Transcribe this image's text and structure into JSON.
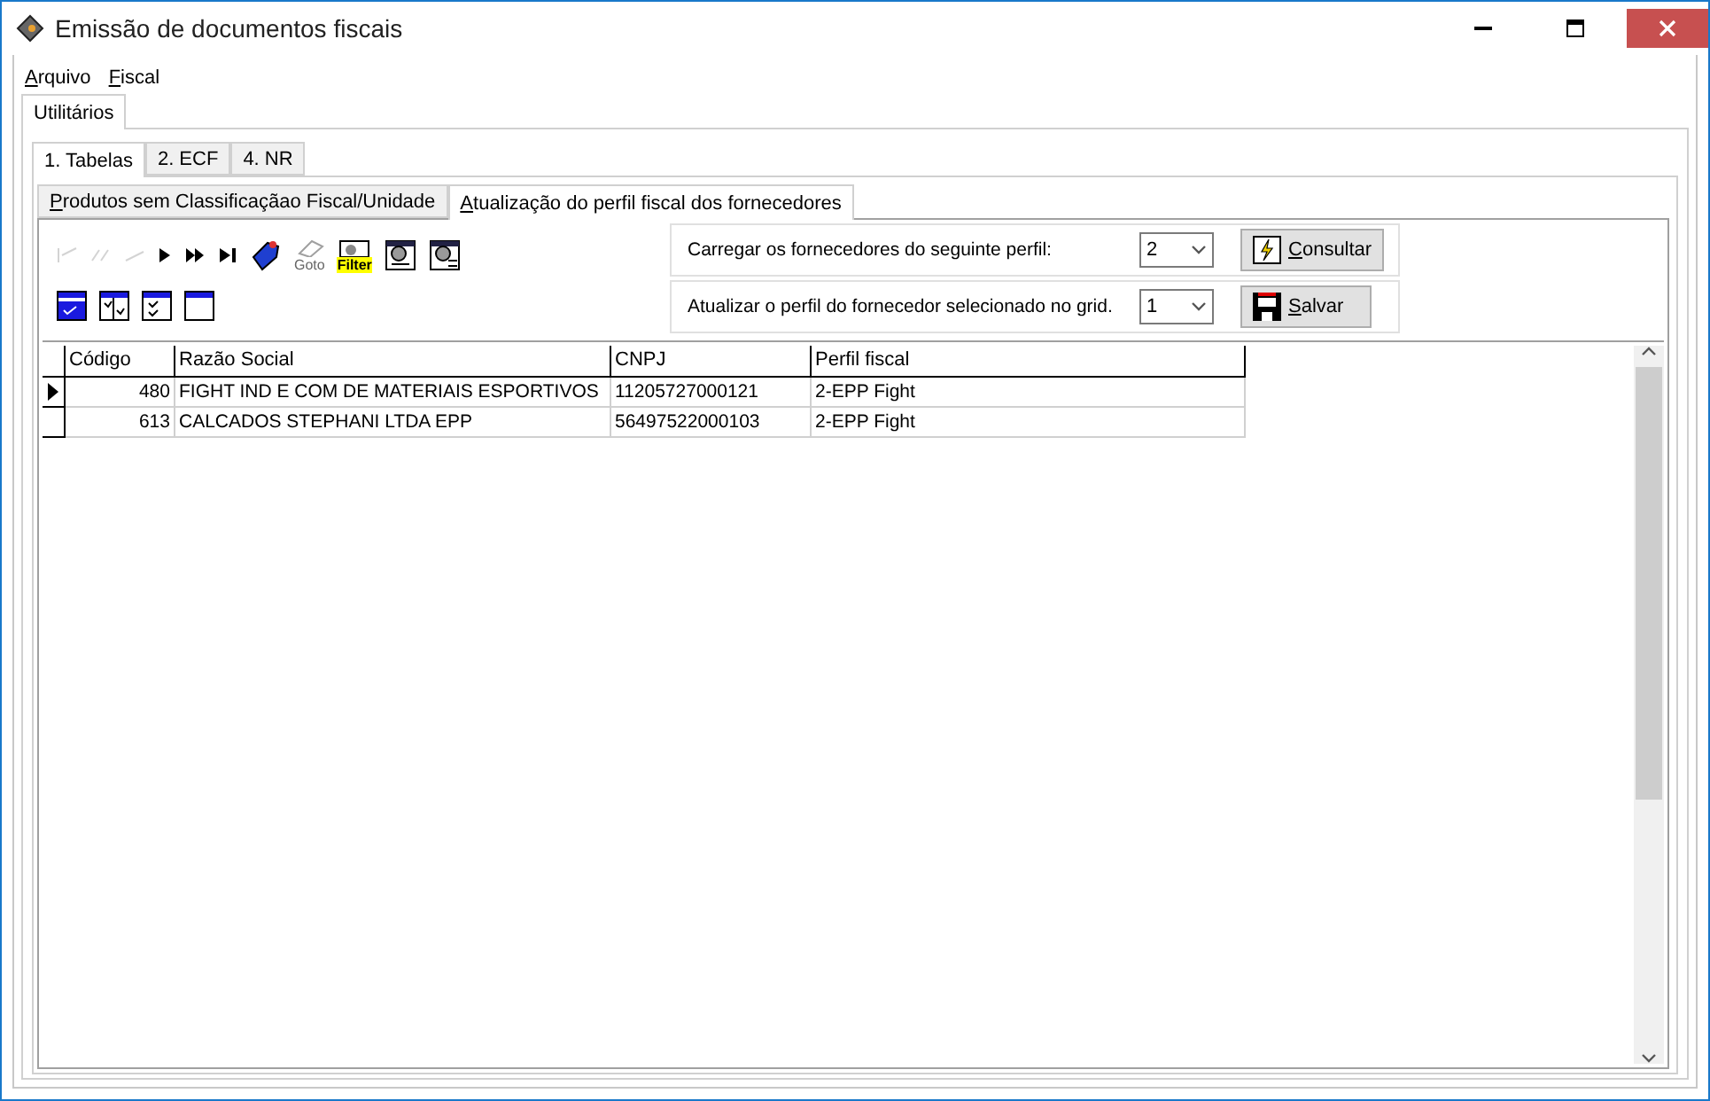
{
  "window": {
    "title": "Emissão de documentos fiscais"
  },
  "menu": [
    "Arquivo",
    "Fiscal"
  ],
  "outer_tabs": [
    {
      "label": "Utilitários",
      "selected": true
    }
  ],
  "tabs": [
    {
      "label": "1. Tabelas",
      "selected": true
    },
    {
      "label": "2. ECF",
      "selected": false
    },
    {
      "label": "4. NR",
      "selected": false
    }
  ],
  "subtabs": [
    {
      "label": "Produtos sem Classificaçãao Fiscal/Unidade",
      "selected": false
    },
    {
      "label": "Atualização do perfil fiscal dos fornecedores",
      "selected": true
    }
  ],
  "toolbar": [
    {
      "kind": "first",
      "disabled": true
    },
    {
      "kind": "prior",
      "disabled": true
    },
    {
      "kind": "prior-page",
      "disabled": true
    },
    {
      "kind": "next",
      "disabled": false
    },
    {
      "kind": "next-page",
      "disabled": false
    },
    {
      "kind": "last",
      "disabled": false
    },
    {
      "kind": "bookmark",
      "disabled": false
    },
    {
      "kind": "goto",
      "disabled": true,
      "label": "Goto"
    },
    {
      "kind": "filter",
      "disabled": false,
      "label": "Filter"
    },
    {
      "kind": "search",
      "disabled": false
    },
    {
      "kind": "search-grid",
      "disabled": false
    }
  ],
  "select_tools": [
    {
      "kind": "select-all"
    },
    {
      "kind": "select-cols"
    },
    {
      "kind": "select-rows"
    },
    {
      "kind": "select-none"
    }
  ],
  "load_profile": {
    "label": "Carregar os fornecedores do seguinte perfil:",
    "value": "2",
    "button": "Consultar"
  },
  "update_profile": {
    "label": "Atualizar o perfil do fornecedor selecionado no grid.",
    "value": "1",
    "button": "Salvar"
  },
  "table": {
    "columns": [
      "Código",
      "Razão Social",
      "CNPJ",
      "Perfil fiscal"
    ],
    "rows": [
      {
        "current": true,
        "cells": [
          "480",
          "FIGHT IND E COM DE MATERIAIS ESPORTIVOS",
          "11205727000121",
          "2-EPP Fight"
        ]
      },
      {
        "current": false,
        "cells": [
          "613",
          "CALCADOS STEPHANI LTDA EPP",
          "56497522000103",
          "2-EPP Fight"
        ]
      }
    ]
  }
}
